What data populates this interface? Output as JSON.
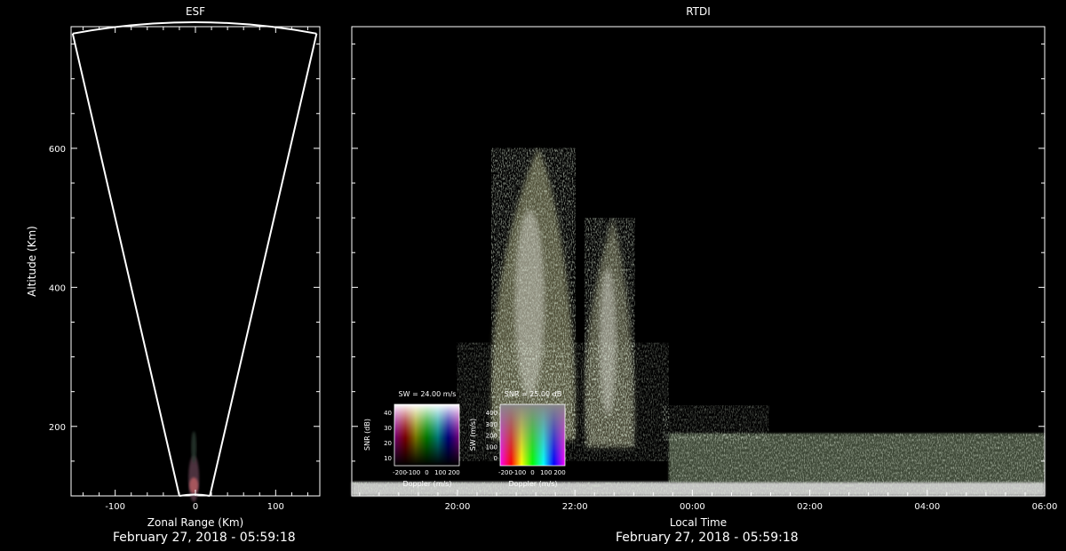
{
  "chart_data": [
    {
      "type": "scatter",
      "panel": "esf",
      "title": "ESF",
      "xlabel": "Zonal Range (Km)",
      "ylabel": "Altitude (Km)",
      "xlim": [
        -155,
        155
      ],
      "ylim": [
        100,
        775
      ],
      "x_ticks": [
        -100,
        0,
        100
      ],
      "y_ticks": [
        200,
        400,
        600
      ],
      "y_minor_step": 50,
      "x_minor_step": 20,
      "fan": {
        "left_edge": [
          [
            -20,
            100
          ],
          [
            -153,
            765
          ]
        ],
        "right_edge": [
          [
            18,
            100
          ],
          [
            151,
            765
          ]
        ],
        "arc_top_altitude": 780
      },
      "timestamp": "February 27, 2018 - 05:59:18"
    },
    {
      "type": "heatmap",
      "panel": "rtdi",
      "title": "RTDI",
      "xlabel": "Local Time",
      "ylabel": "",
      "x_ticks": [
        "20:00",
        "22:00",
        "00:00",
        "02:00",
        "04:00",
        "06:00"
      ],
      "x_range_hours": [
        18.2,
        30.0
      ],
      "ylim": [
        100,
        775
      ],
      "y_ticks": [
        200,
        400,
        600
      ],
      "y_minor_step": 50,
      "x_minor_step_minutes": 20,
      "features": [
        {
          "kind": "plume",
          "t_start": 20.6,
          "t_end": 22.0,
          "alt_bottom": 180,
          "alt_top": 600,
          "color": "#9a9a70"
        },
        {
          "kind": "plume",
          "t_start": 22.2,
          "t_end": 23.0,
          "alt_bottom": 170,
          "alt_top": 500,
          "color": "#8a8a6a"
        },
        {
          "kind": "layer",
          "t_start": 18.2,
          "t_end": 30.0,
          "alt_bottom": 100,
          "alt_top": 120,
          "color": "#d8d8d8"
        },
        {
          "kind": "layer",
          "t_start": 23.6,
          "t_end": 30.0,
          "alt_bottom": 120,
          "alt_top": 190,
          "color": "#8aa07a"
        }
      ],
      "legends": [
        {
          "title": "SW = 24.00 m/s",
          "xlabel": "Doppler (m/s)",
          "ylabel": "SNR (dB)",
          "x_ticks": [
            "-200",
            "-100",
            "0",
            "100",
            "200"
          ],
          "y_ticks": [
            "10",
            "20",
            "30",
            "40"
          ]
        },
        {
          "title": "SNR = 25.00 dB",
          "xlabel": "Doppler (m/s)",
          "ylabel": "SW (m/s)",
          "x_ticks": [
            "-200",
            "-100",
            "0",
            "100",
            "200"
          ],
          "y_ticks": [
            "0",
            "100",
            "200",
            "300",
            "400"
          ]
        }
      ],
      "timestamp": "February 27, 2018 - 05:59:18"
    }
  ]
}
